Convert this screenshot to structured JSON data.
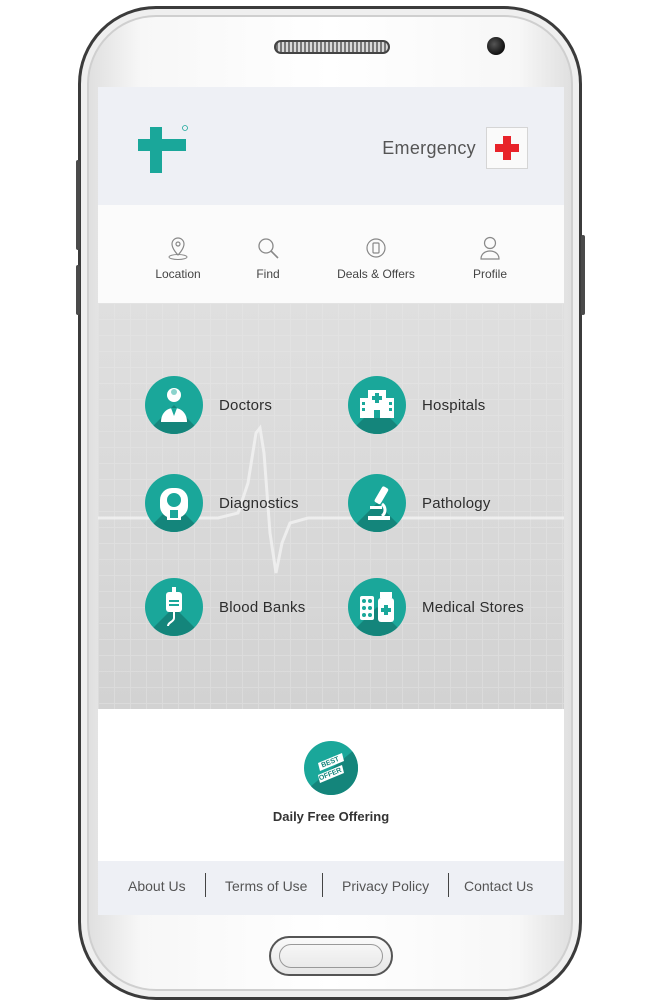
{
  "header": {
    "emergency_label": "Emergency"
  },
  "nav": {
    "items": [
      {
        "label": "Location",
        "icon": "location-pin-icon"
      },
      {
        "label": "Find",
        "icon": "search-icon"
      },
      {
        "label": "Deals & Offers",
        "icon": "deals-icon"
      },
      {
        "label": "Profile",
        "icon": "user-icon"
      }
    ]
  },
  "categories": [
    {
      "label": "Doctors",
      "icon": "doctor-icon"
    },
    {
      "label": "Hospitals",
      "icon": "hospital-icon"
    },
    {
      "label": "Diagnostics",
      "icon": "mri-scanner-icon"
    },
    {
      "label": "Pathology",
      "icon": "microscope-icon"
    },
    {
      "label": "Blood Banks",
      "icon": "iv-bag-icon"
    },
    {
      "label": "Medical Stores",
      "icon": "medicine-icon"
    }
  ],
  "offer": {
    "badge_text_1": "BEST",
    "badge_text_2": "OFFER",
    "label": "Daily Free Offering"
  },
  "footer": {
    "links": [
      "About Us",
      "Terms of Use",
      "Privacy Policy",
      "Contact Us"
    ]
  },
  "colors": {
    "accent": "#1aa79a",
    "accent_dark": "#14857b",
    "emergency_red": "#e8232a",
    "header_bg": "#eef0f5"
  }
}
